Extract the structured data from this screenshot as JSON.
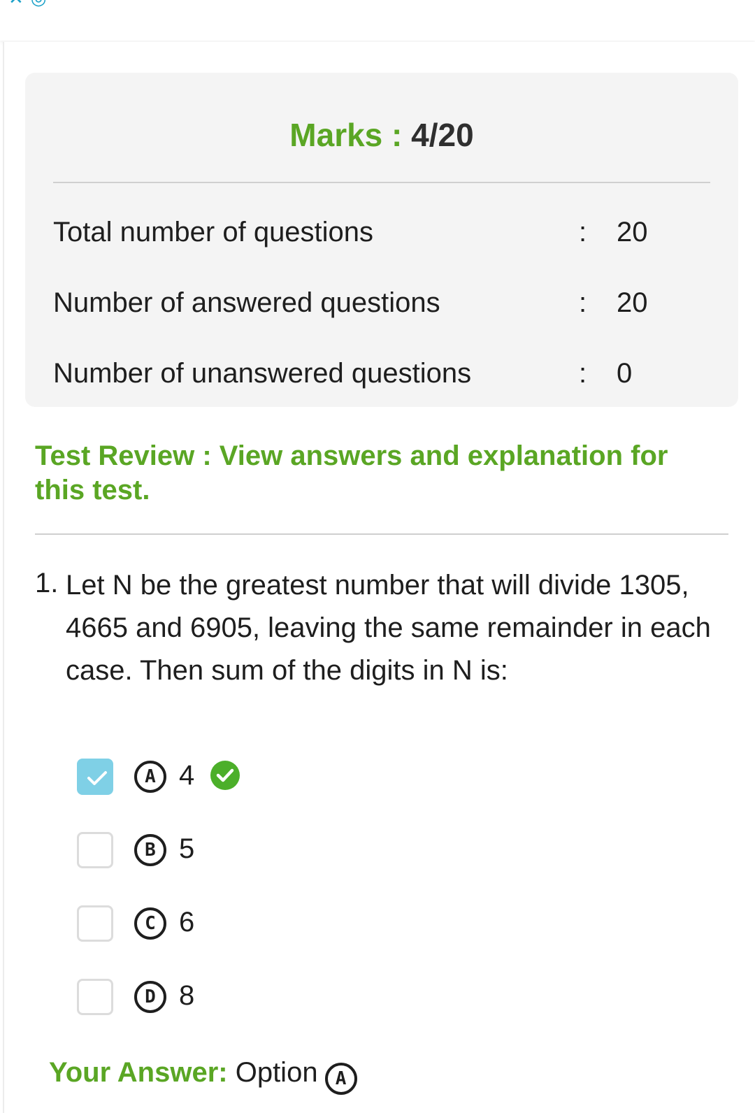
{
  "summary": {
    "marks_label": "Marks : ",
    "marks_value": "4/20",
    "stats": [
      {
        "label": "Total number of questions",
        "colon": ":",
        "value": "20"
      },
      {
        "label": "Number of answered questions",
        "colon": ":",
        "value": "20"
      },
      {
        "label": "Number of unanswered questions",
        "colon": ":",
        "value": "0"
      }
    ]
  },
  "review": {
    "text": "Test Review : View answers and explanation for this test."
  },
  "question": {
    "number": "1.",
    "text": "Let N be the greatest number that will divide 1305, 4665 and 6905, leaving the same remainder in each case. Then sum of the digits in N is:",
    "options": [
      {
        "letter": "A",
        "value": "4",
        "selected": true,
        "correct": true
      },
      {
        "letter": "B",
        "value": "5",
        "selected": false,
        "correct": false
      },
      {
        "letter": "C",
        "value": "6",
        "selected": false,
        "correct": false
      },
      {
        "letter": "D",
        "value": "8",
        "selected": false,
        "correct": false
      }
    ]
  },
  "your_answer": {
    "label": "Your Answer:",
    "text": " Option",
    "letter": "A"
  },
  "colors": {
    "accent_green": "#5aa624",
    "checkbox_checked": "#7fd0e6",
    "correct_green": "#4caf2a"
  }
}
